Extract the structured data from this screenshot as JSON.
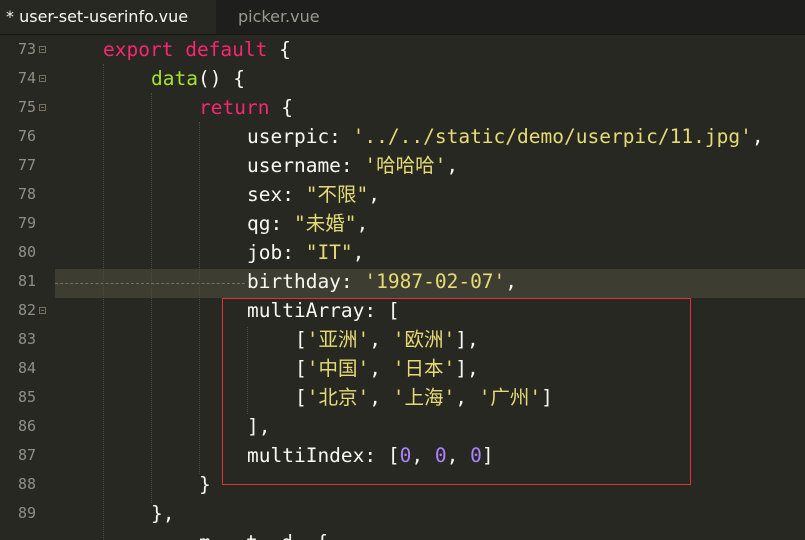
{
  "tabs": [
    {
      "label": "* user-set-userinfo.vue"
    },
    {
      "label": "picker.vue"
    }
  ],
  "lines": [
    {
      "num": "73",
      "tokens": [
        {
          "t": "kw",
          "v": "export"
        },
        {
          "t": "pl",
          "v": " "
        },
        {
          "t": "kw",
          "v": "default"
        },
        {
          "t": "pl",
          "v": " {"
        }
      ]
    },
    {
      "num": "74",
      "tokens": [
        {
          "t": "fn",
          "v": "data"
        },
        {
          "t": "pl",
          "v": "() {"
        }
      ]
    },
    {
      "num": "75",
      "tokens": [
        {
          "t": "kw",
          "v": "return"
        },
        {
          "t": "pl",
          "v": " {"
        }
      ]
    },
    {
      "num": "76",
      "tokens": [
        {
          "t": "pl",
          "v": "userpic: "
        },
        {
          "t": "str",
          "v": "'../../static/demo/userpic/11.jpg'"
        },
        {
          "t": "pl",
          "v": ","
        }
      ]
    },
    {
      "num": "77",
      "tokens": [
        {
          "t": "pl",
          "v": "username: "
        },
        {
          "t": "str",
          "v": "'哈哈哈'"
        },
        {
          "t": "pl",
          "v": ","
        }
      ]
    },
    {
      "num": "78",
      "tokens": [
        {
          "t": "pl",
          "v": "sex: "
        },
        {
          "t": "str",
          "v": "\"不限\""
        },
        {
          "t": "pl",
          "v": ","
        }
      ]
    },
    {
      "num": "79",
      "tokens": [
        {
          "t": "pl",
          "v": "qg: "
        },
        {
          "t": "str",
          "v": "\"未婚\""
        },
        {
          "t": "pl",
          "v": ","
        }
      ]
    },
    {
      "num": "80",
      "tokens": [
        {
          "t": "pl",
          "v": "job: "
        },
        {
          "t": "str",
          "v": "\"IT\""
        },
        {
          "t": "pl",
          "v": ","
        }
      ]
    },
    {
      "num": "81",
      "tokens": [
        {
          "t": "pl",
          "v": "birthday: "
        },
        {
          "t": "str",
          "v": "'1987-02-07'"
        },
        {
          "t": "pl",
          "v": ","
        }
      ]
    },
    {
      "num": "82",
      "tokens": [
        {
          "t": "pl",
          "v": "multiArray: ["
        }
      ]
    },
    {
      "num": "83",
      "tokens": [
        {
          "t": "pl",
          "v": "["
        },
        {
          "t": "str",
          "v": "'亚洲'"
        },
        {
          "t": "pl",
          "v": ", "
        },
        {
          "t": "str",
          "v": "'欧洲'"
        },
        {
          "t": "pl",
          "v": "],"
        }
      ]
    },
    {
      "num": "84",
      "tokens": [
        {
          "t": "pl",
          "v": "["
        },
        {
          "t": "str",
          "v": "'中国'"
        },
        {
          "t": "pl",
          "v": ", "
        },
        {
          "t": "str",
          "v": "'日本'"
        },
        {
          "t": "pl",
          "v": "],"
        }
      ]
    },
    {
      "num": "85",
      "tokens": [
        {
          "t": "pl",
          "v": "["
        },
        {
          "t": "str",
          "v": "'北京'"
        },
        {
          "t": "pl",
          "v": ", "
        },
        {
          "t": "str",
          "v": "'上海'"
        },
        {
          "t": "pl",
          "v": ", "
        },
        {
          "t": "str",
          "v": "'广州'"
        },
        {
          "t": "pl",
          "v": "]"
        }
      ]
    },
    {
      "num": "86",
      "tokens": [
        {
          "t": "pl",
          "v": "],"
        }
      ]
    },
    {
      "num": "87",
      "tokens": [
        {
          "t": "pl",
          "v": "multiIndex: ["
        },
        {
          "t": "num",
          "v": "0"
        },
        {
          "t": "pl",
          "v": ", "
        },
        {
          "t": "num",
          "v": "0"
        },
        {
          "t": "pl",
          "v": ", "
        },
        {
          "t": "num",
          "v": "0"
        },
        {
          "t": "pl",
          "v": "]"
        }
      ]
    },
    {
      "num": "88",
      "tokens": [
        {
          "t": "pl",
          "v": "}"
        }
      ]
    },
    {
      "num": "89",
      "tokens": [
        {
          "t": "pl",
          "v": "},"
        }
      ]
    },
    {
      "num": "",
      "tokens": [
        {
          "t": "pl",
          "v": "m   t  d  {"
        }
      ]
    }
  ],
  "colors": {
    "background": "#272822",
    "keyword": "#f92672",
    "function": "#a6e22e",
    "string": "#e6db74",
    "number": "#ae81ff",
    "highlight_box": "#e0303a"
  }
}
